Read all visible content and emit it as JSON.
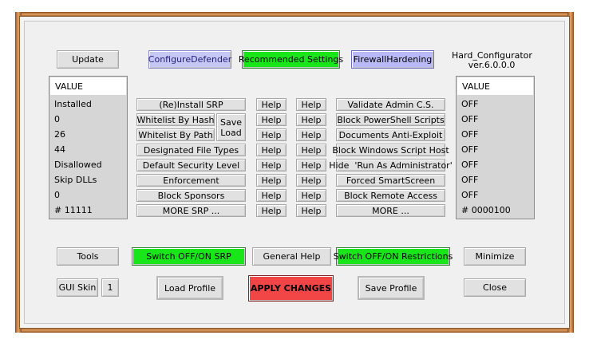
{
  "window": {
    "app_name": "Hard_Configurator",
    "version": "ver.6.0.0.0"
  },
  "top": {
    "update": "Update",
    "configure_defender": "ConfigureDefender",
    "recommended_settings": "Recommended Settings",
    "firewall_hardening": "FirewallHardening"
  },
  "left_list": {
    "header": "VALUE",
    "values": [
      "Installed",
      "0",
      "26",
      "44",
      "Disallowed",
      "Skip DLLs",
      "0",
      "# 11111"
    ]
  },
  "right_list": {
    "header": "VALUE",
    "values": [
      "OFF",
      "OFF",
      "OFF",
      "OFF",
      "OFF",
      "OFF",
      "OFF",
      "# 0000100"
    ]
  },
  "srp_buttons": {
    "reinstall_srp": "(Re)Install SRP",
    "whitelist_by_hash": "Whitelist By Hash",
    "whitelist_by_path": "Whitelist By Path",
    "save_load_line1": "Save",
    "save_load_line2": "Load",
    "designated_file_types": "Designated File Types",
    "default_security_level": "Default Security Level",
    "enforcement": "Enforcement",
    "block_sponsors": "Block Sponsors",
    "more_srp": "MORE SRP ..."
  },
  "help_label": "Help",
  "restriction_buttons": {
    "validate_admin_cs": "Validate Admin C.S.",
    "block_powershell_scripts": "Block PowerShell Scripts",
    "documents_anti_exploit": "Documents Anti-Exploit",
    "block_windows_script_host": "Block Windows Script Host",
    "hide_run_as_administrator": "Hide  'Run As Administrator'",
    "forced_smartscreen": "Forced SmartScreen",
    "block_remote_access": "Block Remote Access",
    "more": "MORE ..."
  },
  "bottom": {
    "tools": "Tools",
    "switch_srp": "Switch OFF/ON SRP",
    "general_help": "General Help",
    "switch_restrictions": "Switch OFF/ON Restrictions",
    "minimize": "Minimize",
    "gui_skin": "GUI Skin",
    "gui_skin_value": "1",
    "load_profile": "Load Profile",
    "apply_changes": "APPLY CHANGES",
    "save_profile": "Save Profile",
    "close": "Close"
  },
  "colors": {
    "green": "#19e619",
    "red": "#f24545",
    "purple": "#b9b9f7",
    "frame": "#c87a3a"
  }
}
